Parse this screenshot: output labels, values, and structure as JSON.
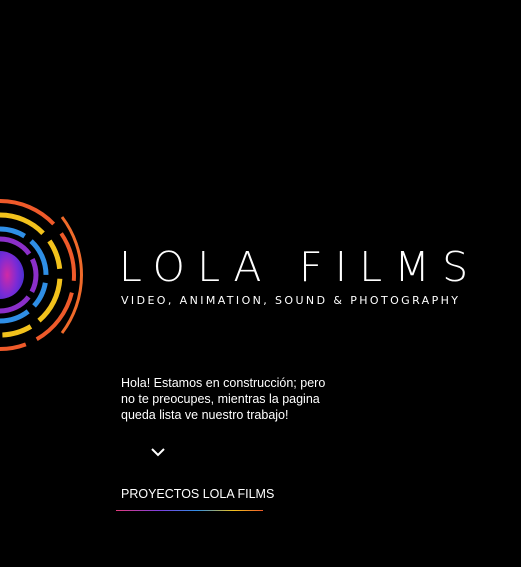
{
  "brand": {
    "title": "LOLA FILMS",
    "subtitle": "VIDEO, ANIMATION, SOUND & PHOTOGRAPHY",
    "logo_icon": "concentric-color-arcs-logo-icon"
  },
  "intro": {
    "text": "Hola! Estamos en construcción; pero no te preocupes, mientras la pagina queda lista ve nuestro trabajo!"
  },
  "scroll": {
    "icon": "chevron-down-icon"
  },
  "projects": {
    "label": "PROYECTOS LOLA FILMS"
  },
  "colors": {
    "background": "#000000",
    "text": "#ffffff",
    "accent_pink": "#e23b7c",
    "accent_purple": "#7b3fe0",
    "accent_blue": "#2f8fe6",
    "accent_yellow": "#f2c21c",
    "accent_orange": "#ef5a2a"
  }
}
